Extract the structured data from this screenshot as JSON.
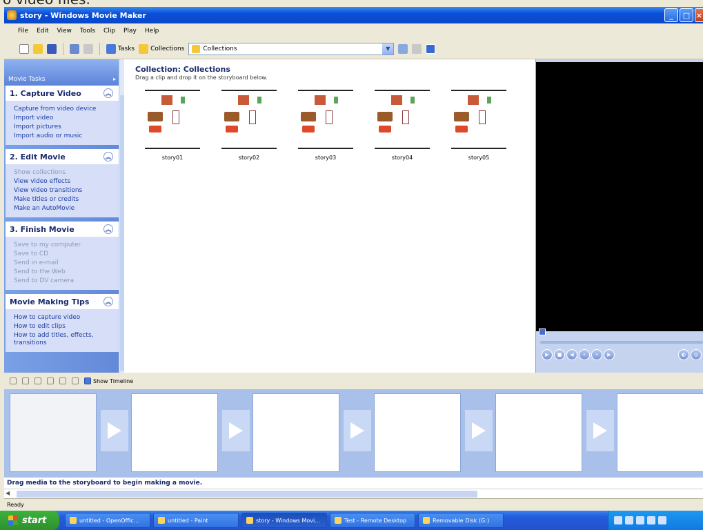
{
  "window": {
    "caption_fragment": "o video files.",
    "title": "story - Windows Movie Maker"
  },
  "menu": [
    "File",
    "Edit",
    "View",
    "Tools",
    "Clip",
    "Play",
    "Help"
  ],
  "toolbar": {
    "tasks_label": "Tasks",
    "collections_label": "Collections",
    "collection_dropdown_value": "Collections"
  },
  "task_pane": {
    "header": "Movie Tasks",
    "groups": [
      {
        "title": "1. Capture Video",
        "items": [
          {
            "label": "Capture from video device",
            "enabled": true
          },
          {
            "label": "Import video",
            "enabled": true
          },
          {
            "label": "Import pictures",
            "enabled": true
          },
          {
            "label": "Import audio or music",
            "enabled": true
          }
        ]
      },
      {
        "title": "2. Edit Movie",
        "items": [
          {
            "label": "Show collections",
            "enabled": false
          },
          {
            "label": "View video effects",
            "enabled": true
          },
          {
            "label": "View video transitions",
            "enabled": true
          },
          {
            "label": "Make titles or credits",
            "enabled": true
          },
          {
            "label": "Make an AutoMovie",
            "enabled": true
          }
        ]
      },
      {
        "title": "3. Finish Movie",
        "items": [
          {
            "label": "Save to my computer",
            "enabled": false
          },
          {
            "label": "Save to CD",
            "enabled": false
          },
          {
            "label": "Send in e-mail",
            "enabled": false
          },
          {
            "label": "Send to the Web",
            "enabled": false
          },
          {
            "label": "Send to DV camera",
            "enabled": false
          }
        ]
      },
      {
        "title": "Movie Making Tips",
        "items": [
          {
            "label": "How to capture video",
            "enabled": true
          },
          {
            "label": "How to edit clips",
            "enabled": true
          },
          {
            "label": "How to add titles, effects, transitions",
            "enabled": true
          }
        ]
      }
    ]
  },
  "collection": {
    "title": "Collection: Collections",
    "subtitle": "Drag a clip and drop it on the storyboard below.",
    "clips": [
      "story01",
      "story02",
      "story03",
      "story04",
      "story05"
    ]
  },
  "storyboard": {
    "toolbar_label": "Show Timeline",
    "message": "Drag media to the storyboard to begin making a movie."
  },
  "status": "Ready",
  "taskbar": {
    "start": "start",
    "tasks": [
      {
        "label": "untitled - OpenOffic...",
        "active": false
      },
      {
        "label": "untitled - Paint",
        "active": false
      },
      {
        "label": "story - Windows Movi...",
        "active": true
      },
      {
        "label": "Test - Remote Desktop",
        "active": false
      },
      {
        "label": "Removable Disk (G:)",
        "active": false
      }
    ]
  }
}
